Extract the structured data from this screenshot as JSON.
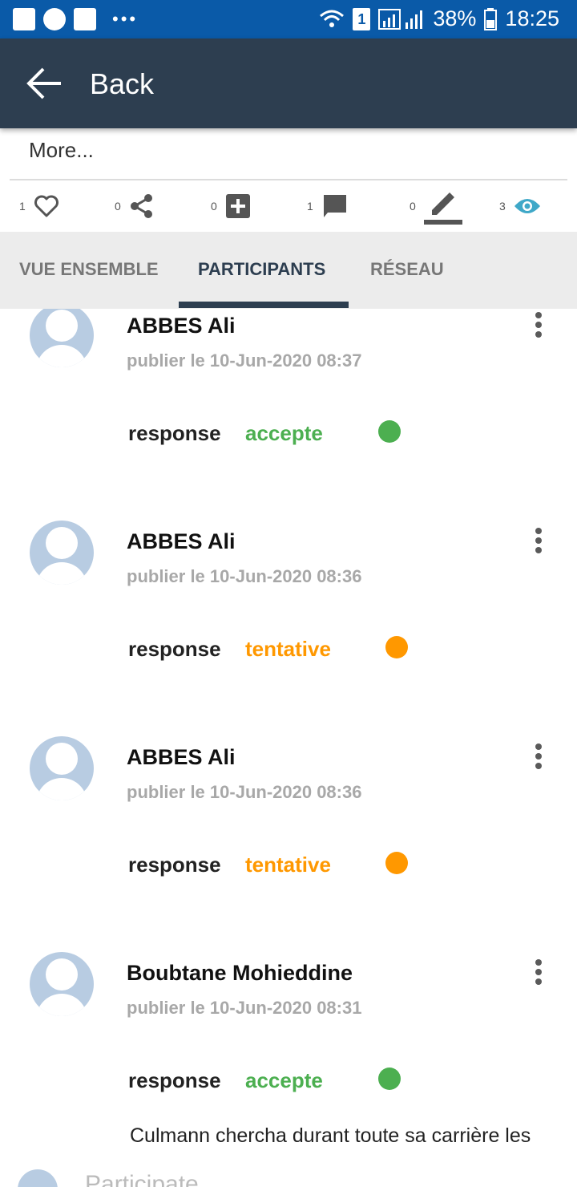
{
  "status_bar": {
    "battery": "38%",
    "time": "18:25",
    "sim": "1",
    "icons": [
      "app-badge-icon",
      "phone-icon",
      "image-icon",
      "more-dots-icon",
      "wifi-icon",
      "sim-icon",
      "signal-icon",
      "battery-icon"
    ],
    "dots": "•••"
  },
  "appbar": {
    "back_label": "Back"
  },
  "post": {
    "more_label": "More...",
    "stats": [
      {
        "icon": "heart-icon",
        "count": "1"
      },
      {
        "icon": "share-icon",
        "count": "0"
      },
      {
        "icon": "add-box-icon",
        "count": "0"
      },
      {
        "icon": "comment-icon",
        "count": "1"
      },
      {
        "icon": "edit-icon",
        "count": "0"
      },
      {
        "icon": "eye-icon",
        "count": "3"
      }
    ]
  },
  "tabs": [
    {
      "label": "VUE ENSEMBLE",
      "active": false
    },
    {
      "label": "PARTICIPANTS",
      "active": true
    },
    {
      "label": "RÉSEAU",
      "active": false
    }
  ],
  "participants": [
    {
      "name": "ABBES  Ali",
      "date": "publier le 10-Jun-2020 08:37",
      "response_label": "response",
      "response": "accepte",
      "color": "#4caf50"
    },
    {
      "name": "ABBES  Ali",
      "date": "publier le 10-Jun-2020 08:36",
      "response_label": "response",
      "response": "tentative",
      "color": "#ff9800"
    },
    {
      "name": "ABBES  Ali",
      "date": "publier le 10-Jun-2020 08:36",
      "response_label": "response",
      "response": "tentative",
      "color": "#ff9800"
    },
    {
      "name": "Boubtane  Mohieddine",
      "date": "publier le 10-Jun-2020 08:31",
      "response_label": "response",
      "response": "accepte",
      "color": "#4caf50"
    }
  ],
  "comment_text": "Culmann chercha durant toute sa carrière les",
  "partial_section": "Participate",
  "colors": {
    "appbar": "#2d3e50",
    "status_bar": "#0a5aa8",
    "accept": "#4caf50",
    "tentative": "#ff9800",
    "eye": "#3fa8c8"
  }
}
